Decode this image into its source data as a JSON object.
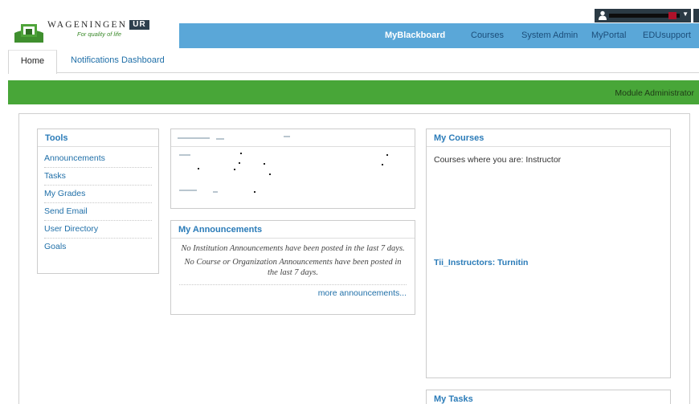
{
  "header": {
    "logo": {
      "wordmark": "WAGENINGEN",
      "wordmark_ur": "UR",
      "tagline": "For quality of life"
    },
    "nav": [
      {
        "label": "MyBlackboard",
        "active": true
      },
      {
        "label": "Courses",
        "active": false
      },
      {
        "label": "System Admin",
        "active": false
      },
      {
        "label": "MyPortal",
        "active": false
      },
      {
        "label": "EDUsupport",
        "active": false
      }
    ]
  },
  "tabs": {
    "home": "Home",
    "notifications": "Notifications Dashboard"
  },
  "role_bar": {
    "label": "Module Administrator"
  },
  "tools": {
    "title": "Tools",
    "items": [
      "Announcements",
      "Tasks",
      "My Grades",
      "Send Email",
      "User Directory",
      "Goals"
    ]
  },
  "announcements": {
    "title": "My Announcements",
    "institution_msg": "No Institution Announcements have been posted in the last 7 days.",
    "course_msg": "No Course or Organization Announcements have been posted in the last 7 days.",
    "more_link": "more announcements..."
  },
  "courses": {
    "title": "My Courses",
    "subtitle": "Courses where you are: Instructor",
    "course_link": "Tii_Instructors: Turnitin"
  },
  "tasks": {
    "title": "My Tasks"
  },
  "colors": {
    "nav_blue": "#5aa7d8",
    "role_green": "#48a638",
    "link_blue": "#1f6fa8",
    "heading_blue": "#2a7bb8"
  }
}
